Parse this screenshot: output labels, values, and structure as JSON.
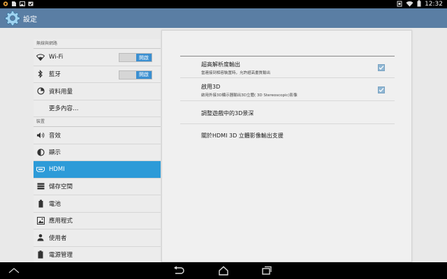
{
  "statusbar": {
    "clock": "12:32",
    "left_icons": [
      "sync-icon",
      "sd-card-icon",
      "image-icon",
      "checkbox-icon"
    ],
    "right_icons": [
      "notification-icon",
      "wifi-icon",
      "battery-icon"
    ]
  },
  "actionbar": {
    "title": "設定",
    "icon": "settings-gear-icon"
  },
  "sidebar": {
    "sections": [
      {
        "header": "無線與網路",
        "items": [
          {
            "label": "Wi-Fi",
            "icon": "wifi-icon",
            "toggle": "開啟"
          },
          {
            "label": "藍牙",
            "icon": "bluetooth-icon",
            "toggle": "開啟"
          },
          {
            "label": "資料用量",
            "icon": "data-usage-icon"
          },
          {
            "label": "更多內容…",
            "icon": ""
          }
        ]
      },
      {
        "header": "裝置",
        "items": [
          {
            "label": "音效",
            "icon": "volume-icon"
          },
          {
            "label": "顯示",
            "icon": "display-icon"
          },
          {
            "label": "HDMI",
            "icon": "hdmi-icon",
            "selected": true
          },
          {
            "label": "儲存空間",
            "icon": "storage-icon"
          },
          {
            "label": "電池",
            "icon": "battery-icon"
          },
          {
            "label": "應用程式",
            "icon": "apps-icon"
          },
          {
            "label": "使用者",
            "icon": "user-icon"
          },
          {
            "label": "電源管理",
            "icon": "power-icon"
          }
        ]
      }
    ]
  },
  "detail": {
    "prefs": [
      {
        "title": "超高解析度輸出",
        "summary": "當連接到相容裝置時，允許超高畫質輸出",
        "checked": true
      },
      {
        "title": "啟用3D",
        "summary": "啟用外接3D顯示器輸出3D立體( 3D Stereoscopic)影像",
        "checked": true
      },
      {
        "title": "調整遊戲中的3D景深",
        "summary": ""
      },
      {
        "title": "關於HDMI 3D 立體影像輸出支援",
        "summary": ""
      }
    ]
  },
  "navbar": {
    "buttons": [
      "hide-keyboard-icon",
      "back-icon",
      "home-icon",
      "recent-apps-icon"
    ]
  },
  "colors": {
    "actionbar": "#5a7ea4",
    "selected": "#2d9bd8",
    "toggle_on": "#3a8fd1",
    "checkbox": "#8fb6d3"
  }
}
